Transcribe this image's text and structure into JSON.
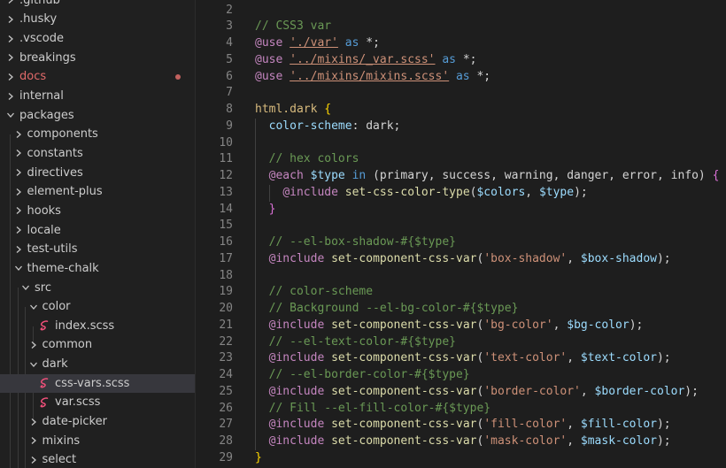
{
  "explorer": {
    "items": [
      {
        "label": ".github",
        "depth": 0,
        "kind": "folder",
        "expanded": false
      },
      {
        "label": ".husky",
        "depth": 0,
        "kind": "folder",
        "expanded": false
      },
      {
        "label": ".vscode",
        "depth": 0,
        "kind": "folder",
        "expanded": false
      },
      {
        "label": "breakings",
        "depth": 0,
        "kind": "folder",
        "expanded": false
      },
      {
        "label": "docs",
        "depth": 0,
        "kind": "folder",
        "expanded": false,
        "modified": true
      },
      {
        "label": "internal",
        "depth": 0,
        "kind": "folder",
        "expanded": false
      },
      {
        "label": "packages",
        "depth": 0,
        "kind": "folder",
        "expanded": true
      },
      {
        "label": "components",
        "depth": 1,
        "kind": "folder",
        "expanded": false
      },
      {
        "label": "constants",
        "depth": 1,
        "kind": "folder",
        "expanded": false
      },
      {
        "label": "directives",
        "depth": 1,
        "kind": "folder",
        "expanded": false
      },
      {
        "label": "element-plus",
        "depth": 1,
        "kind": "folder",
        "expanded": false
      },
      {
        "label": "hooks",
        "depth": 1,
        "kind": "folder",
        "expanded": false
      },
      {
        "label": "locale",
        "depth": 1,
        "kind": "folder",
        "expanded": false
      },
      {
        "label": "test-utils",
        "depth": 1,
        "kind": "folder",
        "expanded": false
      },
      {
        "label": "theme-chalk",
        "depth": 1,
        "kind": "folder",
        "expanded": true
      },
      {
        "label": "src",
        "depth": 2,
        "kind": "folder",
        "expanded": true
      },
      {
        "label": "color",
        "depth": 3,
        "kind": "folder",
        "expanded": true
      },
      {
        "label": "index.scss",
        "depth": 4,
        "kind": "scss"
      },
      {
        "label": "common",
        "depth": 3,
        "kind": "folder",
        "expanded": false
      },
      {
        "label": "dark",
        "depth": 3,
        "kind": "folder",
        "expanded": true
      },
      {
        "label": "css-vars.scss",
        "depth": 4,
        "kind": "scss",
        "selected": true
      },
      {
        "label": "var.scss",
        "depth": 4,
        "kind": "scss"
      },
      {
        "label": "date-picker",
        "depth": 3,
        "kind": "folder",
        "expanded": false
      },
      {
        "label": "mixins",
        "depth": 3,
        "kind": "folder",
        "expanded": false
      },
      {
        "label": "select",
        "depth": 3,
        "kind": "folder",
        "expanded": false
      }
    ]
  },
  "editor": {
    "lines": [
      {
        "n": "2",
        "tokens": []
      },
      {
        "n": "3",
        "tokens": [
          [
            "comment",
            "// CSS3 var"
          ]
        ]
      },
      {
        "n": "4",
        "tokens": [
          [
            "at",
            "@use"
          ],
          [
            "op",
            " "
          ],
          [
            "str",
            "'./var'"
          ],
          [
            "op",
            " "
          ],
          [
            "kw",
            "as"
          ],
          [
            "op",
            " *;"
          ]
        ]
      },
      {
        "n": "5",
        "tokens": [
          [
            "at",
            "@use"
          ],
          [
            "op",
            " "
          ],
          [
            "str",
            "'../mixins/_var.scss'"
          ],
          [
            "op",
            " "
          ],
          [
            "kw",
            "as"
          ],
          [
            "op",
            " *;"
          ]
        ]
      },
      {
        "n": "6",
        "tokens": [
          [
            "at",
            "@use"
          ],
          [
            "op",
            " "
          ],
          [
            "str",
            "'../mixins/mixins.scss'"
          ],
          [
            "op",
            " "
          ],
          [
            "kw",
            "as"
          ],
          [
            "op",
            " *;"
          ]
        ]
      },
      {
        "n": "7",
        "tokens": []
      },
      {
        "n": "8",
        "tokens": [
          [
            "sel",
            "html.dark"
          ],
          [
            "op",
            " "
          ],
          [
            "brace",
            "{"
          ]
        ]
      },
      {
        "n": "9",
        "tokens": [
          [
            "op",
            "  "
          ],
          [
            "prop",
            "color-scheme"
          ],
          [
            "op",
            ": "
          ],
          [
            "val",
            "dark"
          ],
          [
            "op",
            ";"
          ]
        ]
      },
      {
        "n": "10",
        "tokens": []
      },
      {
        "n": "11",
        "tokens": [
          [
            "op",
            "  "
          ],
          [
            "comment",
            "// hex colors"
          ]
        ]
      },
      {
        "n": "12",
        "tokens": [
          [
            "op",
            "  "
          ],
          [
            "at",
            "@each"
          ],
          [
            "op",
            " "
          ],
          [
            "var",
            "$type"
          ],
          [
            "op",
            " "
          ],
          [
            "kw",
            "in"
          ],
          [
            "op",
            " (primary, success, warning, danger, error, info) "
          ],
          [
            "brace2",
            "{"
          ]
        ]
      },
      {
        "n": "13",
        "tokens": [
          [
            "op",
            "    "
          ],
          [
            "at",
            "@include"
          ],
          [
            "op",
            " "
          ],
          [
            "fn",
            "set-css-color-type"
          ],
          [
            "op",
            "("
          ],
          [
            "var",
            "$colors"
          ],
          [
            "op",
            ", "
          ],
          [
            "var",
            "$type"
          ],
          [
            "op",
            ");"
          ]
        ]
      },
      {
        "n": "14",
        "tokens": [
          [
            "op",
            "  "
          ],
          [
            "brace2",
            "}"
          ]
        ]
      },
      {
        "n": "15",
        "tokens": []
      },
      {
        "n": "16",
        "tokens": [
          [
            "op",
            "  "
          ],
          [
            "comment",
            "// --el-box-shadow-#{$type}"
          ]
        ]
      },
      {
        "n": "17",
        "tokens": [
          [
            "op",
            "  "
          ],
          [
            "at",
            "@include"
          ],
          [
            "op",
            " "
          ],
          [
            "fn",
            "set-component-css-var"
          ],
          [
            "op",
            "("
          ],
          [
            "str2",
            "'box-shadow'"
          ],
          [
            "op",
            ", "
          ],
          [
            "var",
            "$box-shadow"
          ],
          [
            "op",
            ");"
          ]
        ]
      },
      {
        "n": "18",
        "tokens": []
      },
      {
        "n": "19",
        "tokens": [
          [
            "op",
            "  "
          ],
          [
            "comment",
            "// color-scheme"
          ]
        ]
      },
      {
        "n": "20",
        "tokens": [
          [
            "op",
            "  "
          ],
          [
            "comment",
            "// Background --el-bg-color-#{$type}"
          ]
        ]
      },
      {
        "n": "21",
        "tokens": [
          [
            "op",
            "  "
          ],
          [
            "at",
            "@include"
          ],
          [
            "op",
            " "
          ],
          [
            "fn",
            "set-component-css-var"
          ],
          [
            "op",
            "("
          ],
          [
            "str2",
            "'bg-color'"
          ],
          [
            "op",
            ", "
          ],
          [
            "var",
            "$bg-color"
          ],
          [
            "op",
            ");"
          ]
        ]
      },
      {
        "n": "22",
        "tokens": [
          [
            "op",
            "  "
          ],
          [
            "comment",
            "// --el-text-color-#{$type}"
          ]
        ]
      },
      {
        "n": "23",
        "tokens": [
          [
            "op",
            "  "
          ],
          [
            "at",
            "@include"
          ],
          [
            "op",
            " "
          ],
          [
            "fn",
            "set-component-css-var"
          ],
          [
            "op",
            "("
          ],
          [
            "str2",
            "'text-color'"
          ],
          [
            "op",
            ", "
          ],
          [
            "var",
            "$text-color"
          ],
          [
            "op",
            ");"
          ]
        ]
      },
      {
        "n": "24",
        "tokens": [
          [
            "op",
            "  "
          ],
          [
            "comment",
            "// --el-border-color-#{$type}"
          ]
        ]
      },
      {
        "n": "25",
        "tokens": [
          [
            "op",
            "  "
          ],
          [
            "at",
            "@include"
          ],
          [
            "op",
            " "
          ],
          [
            "fn",
            "set-component-css-var"
          ],
          [
            "op",
            "("
          ],
          [
            "str2",
            "'border-color'"
          ],
          [
            "op",
            ", "
          ],
          [
            "var",
            "$border-color"
          ],
          [
            "op",
            ");"
          ]
        ]
      },
      {
        "n": "26",
        "tokens": [
          [
            "op",
            "  "
          ],
          [
            "comment",
            "// Fill --el-fill-color-#{$type}"
          ]
        ]
      },
      {
        "n": "27",
        "tokens": [
          [
            "op",
            "  "
          ],
          [
            "at",
            "@include"
          ],
          [
            "op",
            " "
          ],
          [
            "fn",
            "set-component-css-var"
          ],
          [
            "op",
            "("
          ],
          [
            "str2",
            "'fill-color'"
          ],
          [
            "op",
            ", "
          ],
          [
            "var",
            "$fill-color"
          ],
          [
            "op",
            ");"
          ]
        ]
      },
      {
        "n": "28",
        "tokens": [
          [
            "op",
            "  "
          ],
          [
            "at",
            "@include"
          ],
          [
            "op",
            " "
          ],
          [
            "fn",
            "set-component-css-var"
          ],
          [
            "op",
            "("
          ],
          [
            "str2",
            "'mask-color'"
          ],
          [
            "op",
            ", "
          ],
          [
            "var",
            "$mask-color"
          ],
          [
            "op",
            ");"
          ]
        ]
      },
      {
        "n": "29",
        "tokens": [
          [
            "brace",
            "}"
          ]
        ]
      }
    ]
  },
  "colors": {
    "background": "#1e1e1e",
    "sidebar": "#202020",
    "selected_row": "#37373d",
    "modified": "#e26a6a"
  }
}
